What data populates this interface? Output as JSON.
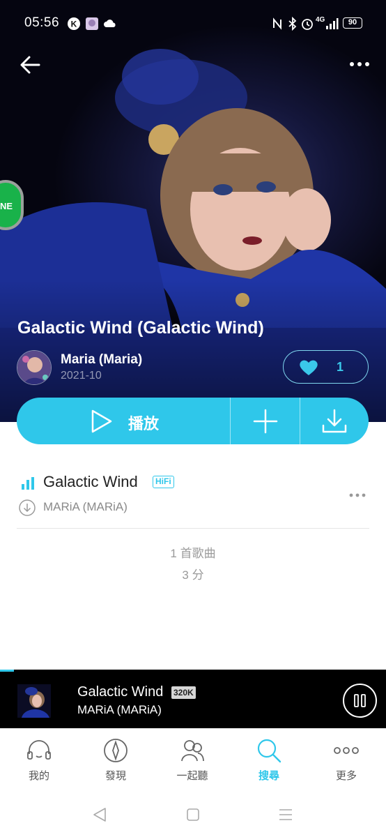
{
  "status_bar": {
    "time": "05:56",
    "network": "4G",
    "battery": "90"
  },
  "album": {
    "title": "Galactic Wind (Galactic Wind)",
    "artist": "Maria (Maria)",
    "release_date": "2021-10",
    "like_count": "1"
  },
  "side_bubble": {
    "label": "NE"
  },
  "actions": {
    "play_label": "播放"
  },
  "tracks": [
    {
      "title": "Galactic Wind",
      "badge": "HiFi",
      "artist": "MARiA (MARiA)"
    }
  ],
  "summary": {
    "count_text": "1 首歌曲",
    "duration_text": "3 分"
  },
  "mini_player": {
    "title": "Galactic Wind",
    "quality": "320K",
    "artist": "MARiA (MARiA)"
  },
  "bottom_nav": [
    {
      "label": "我的",
      "icon": "headphones-icon"
    },
    {
      "label": "發現",
      "icon": "compass-icon"
    },
    {
      "label": "一起聽",
      "icon": "listen-together-icon"
    },
    {
      "label": "搜尋",
      "icon": "search-icon",
      "active": true
    },
    {
      "label": "更多",
      "icon": "more-dots-icon"
    }
  ],
  "colors": {
    "accent": "#2fc7ea",
    "hero_bg": "#0b0c24",
    "player_bg": "#000000"
  }
}
